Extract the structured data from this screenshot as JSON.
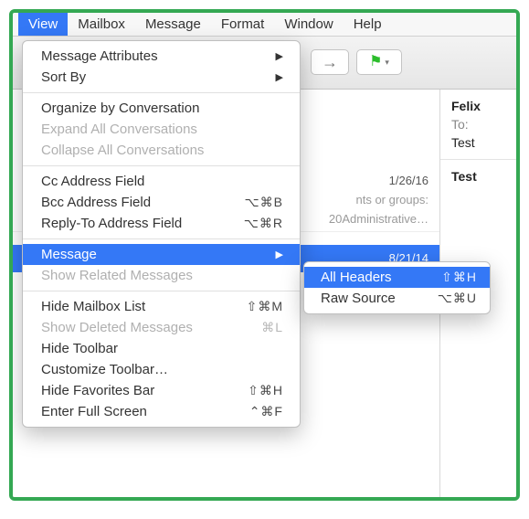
{
  "menubar": {
    "items": [
      {
        "label": "View",
        "active": true
      },
      {
        "label": "Mailbox",
        "active": false
      },
      {
        "label": "Message",
        "active": false
      },
      {
        "label": "Format",
        "active": false
      },
      {
        "label": "Window",
        "active": false
      },
      {
        "label": "Help",
        "active": false
      }
    ]
  },
  "dropdown": {
    "items": [
      {
        "label": "Message Attributes",
        "submenu": true
      },
      {
        "label": "Sort By",
        "submenu": true
      },
      {
        "sep": true
      },
      {
        "label": "Organize by Conversation"
      },
      {
        "label": "Expand All Conversations",
        "disabled": true
      },
      {
        "label": "Collapse All Conversations",
        "disabled": true
      },
      {
        "sep": true
      },
      {
        "label": "Cc Address Field"
      },
      {
        "label": "Bcc Address Field",
        "shortcut": "⌥⌘B"
      },
      {
        "label": "Reply-To Address Field",
        "shortcut": "⌥⌘R"
      },
      {
        "sep": true
      },
      {
        "label": "Message",
        "submenu": true,
        "highlight": true
      },
      {
        "label": "Show Related Messages",
        "disabled": true
      },
      {
        "sep": true
      },
      {
        "label": "Hide Mailbox List",
        "shortcut": "⇧⌘M"
      },
      {
        "label": "Show Deleted Messages",
        "shortcut": "⌘L",
        "disabled": true
      },
      {
        "label": "Hide Toolbar"
      },
      {
        "label": "Customize Toolbar…"
      },
      {
        "label": "Hide Favorites Bar",
        "shortcut": "⇧⌘H"
      },
      {
        "label": "Enter Full Screen",
        "shortcut": "⌃⌘F"
      }
    ]
  },
  "submenu": {
    "items": [
      {
        "label": "All Headers",
        "shortcut": "⇧⌘H",
        "highlight": true
      },
      {
        "label": "Raw Source",
        "shortcut": "⌥⌘U"
      }
    ]
  },
  "background": {
    "date1": "1/26/16",
    "snippet1": "nts or groups:",
    "snippet2": "20Administrative…",
    "date2": "8/21/14",
    "preview": {
      "from": "Felix",
      "toLabel": "To:",
      "subj1": "Test",
      "subj2": "Test"
    }
  }
}
